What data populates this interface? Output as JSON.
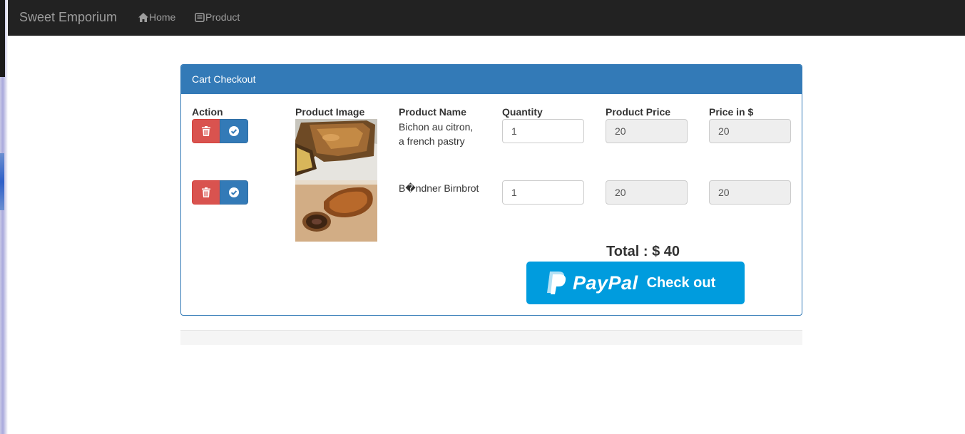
{
  "navbar": {
    "brand": "Sweet Emporium",
    "links": [
      {
        "label": "Home",
        "icon": "home-icon"
      },
      {
        "label": "Product",
        "icon": "product-icon"
      }
    ]
  },
  "panel": {
    "title": "Cart Checkout",
    "columns": [
      "Action",
      "Product Image",
      "Product Name",
      "Quantity",
      "Product Price",
      "Price in $"
    ],
    "rows": [
      {
        "name_line1": "Bichon au citron,",
        "name_line2": "a french pastry",
        "quantity": "1",
        "product_price": "20",
        "price": "20",
        "delete_icon": "trash-icon",
        "update_icon": "check-circle-icon"
      },
      {
        "name": "B�ndner Birnbrot",
        "quantity": "1",
        "product_price": "20",
        "price": "20",
        "delete_icon": "trash-icon",
        "update_icon": "check-circle-icon"
      }
    ],
    "total": "Total : $ 40"
  },
  "paypal": {
    "brand": "PayPal",
    "label": "Check out",
    "color": "#009cde"
  },
  "colors": {
    "navbar": "#222222",
    "primary": "#337ab7",
    "danger": "#d9534f"
  }
}
